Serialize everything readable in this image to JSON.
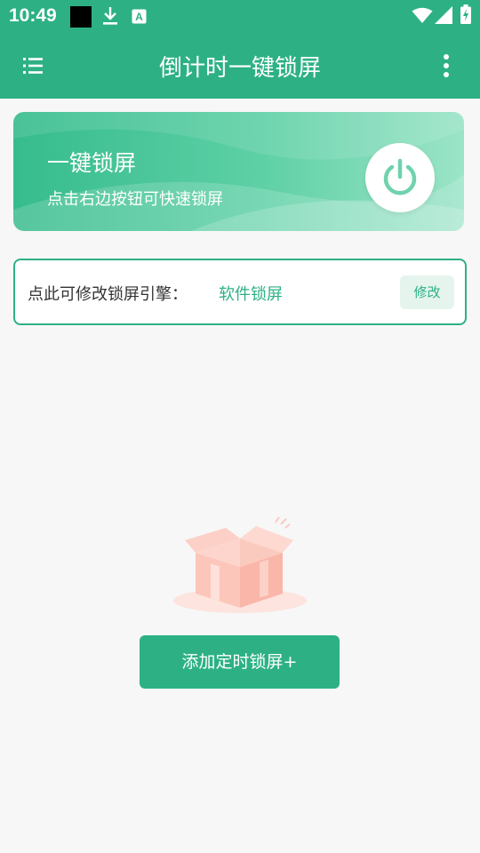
{
  "status_bar": {
    "time": "10:49",
    "icons": [
      "notification-square-icon",
      "download-icon",
      "font-a-icon",
      "wifi-icon",
      "signal-icon",
      "battery-charging-icon"
    ]
  },
  "app_bar": {
    "title": "倒计时一键锁屏",
    "menu_icon": "menu-list-icon",
    "more_icon": "more-vert-icon"
  },
  "banner": {
    "title": "一键锁屏",
    "subtitle": "点击右边按钮可快速锁屏",
    "icon": "power-icon"
  },
  "engine": {
    "label": "点此可修改锁屏引擎：",
    "value": "软件锁屏",
    "modify_label": "修改"
  },
  "empty_state": {
    "icon": "empty-box-icon"
  },
  "add_button": {
    "label": "添加定时锁屏+"
  },
  "colors": {
    "primary": "#2db184",
    "primary_light": "#e5f5ee",
    "background": "#f7f7f7",
    "illustration": "#fbc9bf"
  }
}
